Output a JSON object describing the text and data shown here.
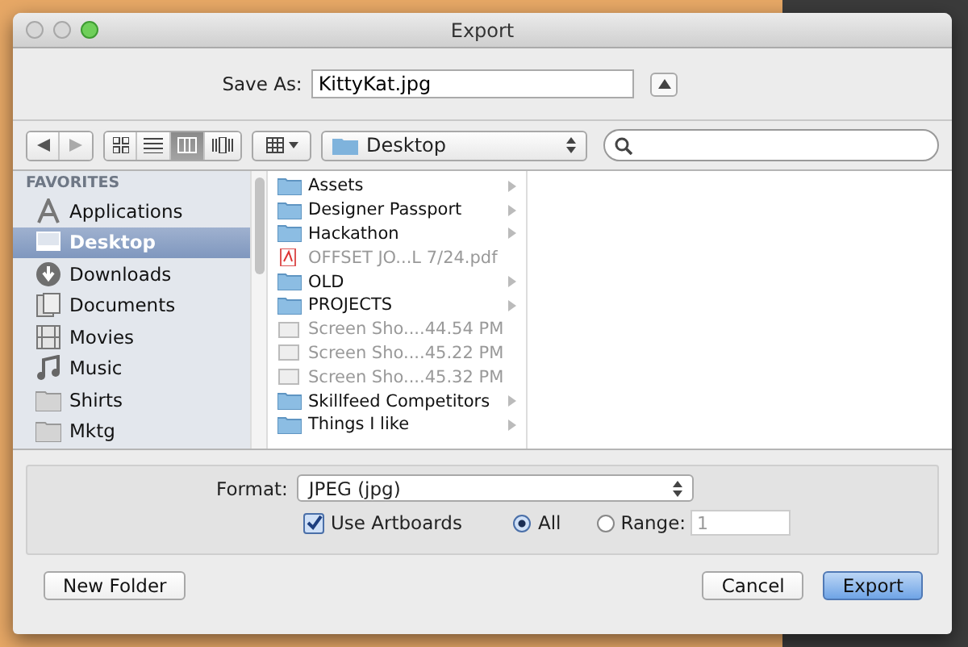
{
  "window": {
    "title": "Export"
  },
  "save_as": {
    "label": "Save As:",
    "value": "KittyKat.jpg"
  },
  "toolbar": {
    "view_modes": [
      {
        "kind": "icons",
        "selected": false
      },
      {
        "kind": "list",
        "selected": false
      },
      {
        "kind": "columns",
        "selected": true
      },
      {
        "kind": "coverflow",
        "selected": false
      }
    ],
    "location": "Desktop"
  },
  "sidebar": {
    "heading": "FAVORITES",
    "items": [
      {
        "label": "Applications",
        "kind": "apps",
        "selected": false
      },
      {
        "label": "Desktop",
        "kind": "desktop",
        "selected": true
      },
      {
        "label": "Downloads",
        "kind": "downloads",
        "selected": false
      },
      {
        "label": "Documents",
        "kind": "documents",
        "selected": false
      },
      {
        "label": "Movies",
        "kind": "movies",
        "selected": false
      },
      {
        "label": "Music",
        "kind": "music",
        "selected": false
      },
      {
        "label": "Shirts",
        "kind": "folder",
        "selected": false
      },
      {
        "label": "Mktg",
        "kind": "folder",
        "selected": false
      }
    ]
  },
  "files": [
    {
      "name": "Assets",
      "kind": "folder"
    },
    {
      "name": "Designer Passport",
      "kind": "folder"
    },
    {
      "name": "Hackathon",
      "kind": "folder"
    },
    {
      "name": "OFFSET JO...L 7/24.pdf",
      "kind": "pdf"
    },
    {
      "name": "OLD",
      "kind": "folder"
    },
    {
      "name": "PROJECTS",
      "kind": "folder"
    },
    {
      "name": "Screen Sho....44.54 PM",
      "kind": "image"
    },
    {
      "name": "Screen Sho....45.22 PM",
      "kind": "image"
    },
    {
      "name": "Screen Sho....45.32 PM",
      "kind": "image"
    },
    {
      "name": "Skillfeed Competitors",
      "kind": "folder"
    },
    {
      "name": "Things I like",
      "kind": "folder"
    }
  ],
  "options": {
    "format_label": "Format:",
    "format": "JPEG (jpg)",
    "use_artboards": {
      "label": "Use Artboards",
      "checked": true
    },
    "radios": [
      {
        "label": "All",
        "selected": true
      },
      {
        "label": "Range:",
        "selected": false
      }
    ],
    "range_value": "1"
  },
  "buttons": {
    "new_folder": "New Folder",
    "cancel": "Cancel",
    "export": "Export"
  }
}
